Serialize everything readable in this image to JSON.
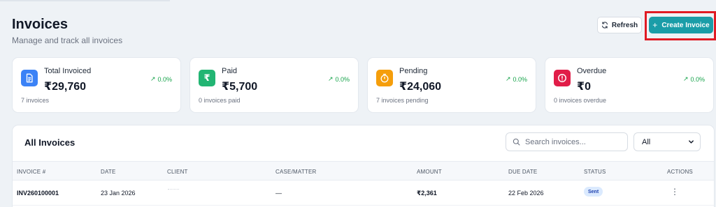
{
  "header": {
    "title": "Invoices",
    "subtitle": "Manage and track all invoices",
    "refresh_label": "Refresh",
    "create_label": "Create Invoice",
    "create_icon": "+"
  },
  "stats": [
    {
      "label": "Total Invoiced",
      "value": "₹29,760",
      "trend": "0.0%",
      "trend_icon": "↗",
      "footnote": "7 invoices",
      "icon": "document-icon",
      "color": "#3b82f6"
    },
    {
      "label": "Paid",
      "value": "₹5,700",
      "trend": "0.0%",
      "trend_icon": "↗",
      "footnote": "0 invoices paid",
      "icon": "rupee-icon",
      "icon_glyph": "₹",
      "color": "#22b573"
    },
    {
      "label": "Pending",
      "value": "₹24,060",
      "trend": "0.0%",
      "trend_icon": "↗",
      "footnote": "7 invoices pending",
      "icon": "timer-icon",
      "color": "#f59e0b"
    },
    {
      "label": "Overdue",
      "value": "₹0",
      "trend": "0.0%",
      "trend_icon": "↗",
      "footnote": "0 invoices overdue",
      "icon": "alert-icon",
      "color": "#e11d48"
    }
  ],
  "table": {
    "title": "All Invoices",
    "search_placeholder": "Search invoices...",
    "filter_value": "All",
    "columns": [
      "INVOICE #",
      "DATE",
      "CLIENT",
      "CASE/MATTER",
      "AMOUNT",
      "DUE DATE",
      "STATUS",
      "ACTIONS"
    ],
    "rows": [
      {
        "invoice": "INV260100001",
        "date": "23 Jan 2026",
        "client": "",
        "case": "—",
        "amount": "₹2,361",
        "due": "22 Feb 2026",
        "status": "Sent",
        "actions": "⋮"
      }
    ]
  },
  "colors": {
    "accent": "#1a9da8",
    "highlight": "#e01b24",
    "trend_up": "#16a34a",
    "status_sent_bg": "#dbeafe"
  }
}
